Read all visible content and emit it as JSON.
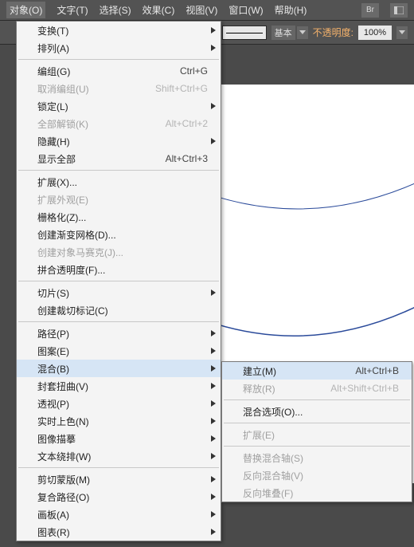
{
  "menubar": {
    "items": [
      "对象(O)",
      "文字(T)",
      "选择(S)",
      "效果(C)",
      "视图(V)",
      "窗口(W)",
      "帮助(H)"
    ],
    "br_label": "Br"
  },
  "toolbar": {
    "basic_label": "基本",
    "opacity_label": "不透明度:",
    "opacity_value": "100%"
  },
  "main_menu": [
    {
      "type": "item",
      "label": "变换(T)",
      "arrow": true
    },
    {
      "type": "item",
      "label": "排列(A)",
      "arrow": true
    },
    {
      "type": "sep"
    },
    {
      "type": "item",
      "label": "编组(G)",
      "shortcut": "Ctrl+G"
    },
    {
      "type": "item",
      "label": "取消编组(U)",
      "shortcut": "Shift+Ctrl+G",
      "disabled": true
    },
    {
      "type": "item",
      "label": "锁定(L)",
      "arrow": true
    },
    {
      "type": "item",
      "label": "全部解锁(K)",
      "shortcut": "Alt+Ctrl+2",
      "disabled": true
    },
    {
      "type": "item",
      "label": "隐藏(H)",
      "arrow": true
    },
    {
      "type": "item",
      "label": "显示全部",
      "shortcut": "Alt+Ctrl+3"
    },
    {
      "type": "sep"
    },
    {
      "type": "item",
      "label": "扩展(X)..."
    },
    {
      "type": "item",
      "label": "扩展外观(E)",
      "disabled": true
    },
    {
      "type": "item",
      "label": "栅格化(Z)..."
    },
    {
      "type": "item",
      "label": "创建渐变网格(D)..."
    },
    {
      "type": "item",
      "label": "创建对象马赛克(J)...",
      "disabled": true
    },
    {
      "type": "item",
      "label": "拼合透明度(F)..."
    },
    {
      "type": "sep"
    },
    {
      "type": "item",
      "label": "切片(S)",
      "arrow": true
    },
    {
      "type": "item",
      "label": "创建裁切标记(C)"
    },
    {
      "type": "sep"
    },
    {
      "type": "item",
      "label": "路径(P)",
      "arrow": true
    },
    {
      "type": "item",
      "label": "图案(E)",
      "arrow": true
    },
    {
      "type": "item",
      "label": "混合(B)",
      "arrow": true,
      "hover": true
    },
    {
      "type": "item",
      "label": "封套扭曲(V)",
      "arrow": true
    },
    {
      "type": "item",
      "label": "透视(P)",
      "arrow": true
    },
    {
      "type": "item",
      "label": "实时上色(N)",
      "arrow": true
    },
    {
      "type": "item",
      "label": "图像描摹",
      "arrow": true
    },
    {
      "type": "item",
      "label": "文本绕排(W)",
      "arrow": true
    },
    {
      "type": "sep"
    },
    {
      "type": "item",
      "label": "剪切蒙版(M)",
      "arrow": true
    },
    {
      "type": "item",
      "label": "复合路径(O)",
      "arrow": true
    },
    {
      "type": "item",
      "label": "画板(A)",
      "arrow": true
    },
    {
      "type": "item",
      "label": "图表(R)",
      "arrow": true
    }
  ],
  "sub_menu": [
    {
      "type": "item",
      "label": "建立(M)",
      "shortcut": "Alt+Ctrl+B",
      "hover": true
    },
    {
      "type": "item",
      "label": "释放(R)",
      "shortcut": "Alt+Shift+Ctrl+B",
      "disabled": true
    },
    {
      "type": "sep"
    },
    {
      "type": "item",
      "label": "混合选项(O)..."
    },
    {
      "type": "sep"
    },
    {
      "type": "item",
      "label": "扩展(E)",
      "disabled": true
    },
    {
      "type": "sep"
    },
    {
      "type": "item",
      "label": "替换混合轴(S)",
      "disabled": true
    },
    {
      "type": "item",
      "label": "反向混合轴(V)",
      "disabled": true
    },
    {
      "type": "item",
      "label": "反向堆叠(F)",
      "disabled": true
    }
  ]
}
